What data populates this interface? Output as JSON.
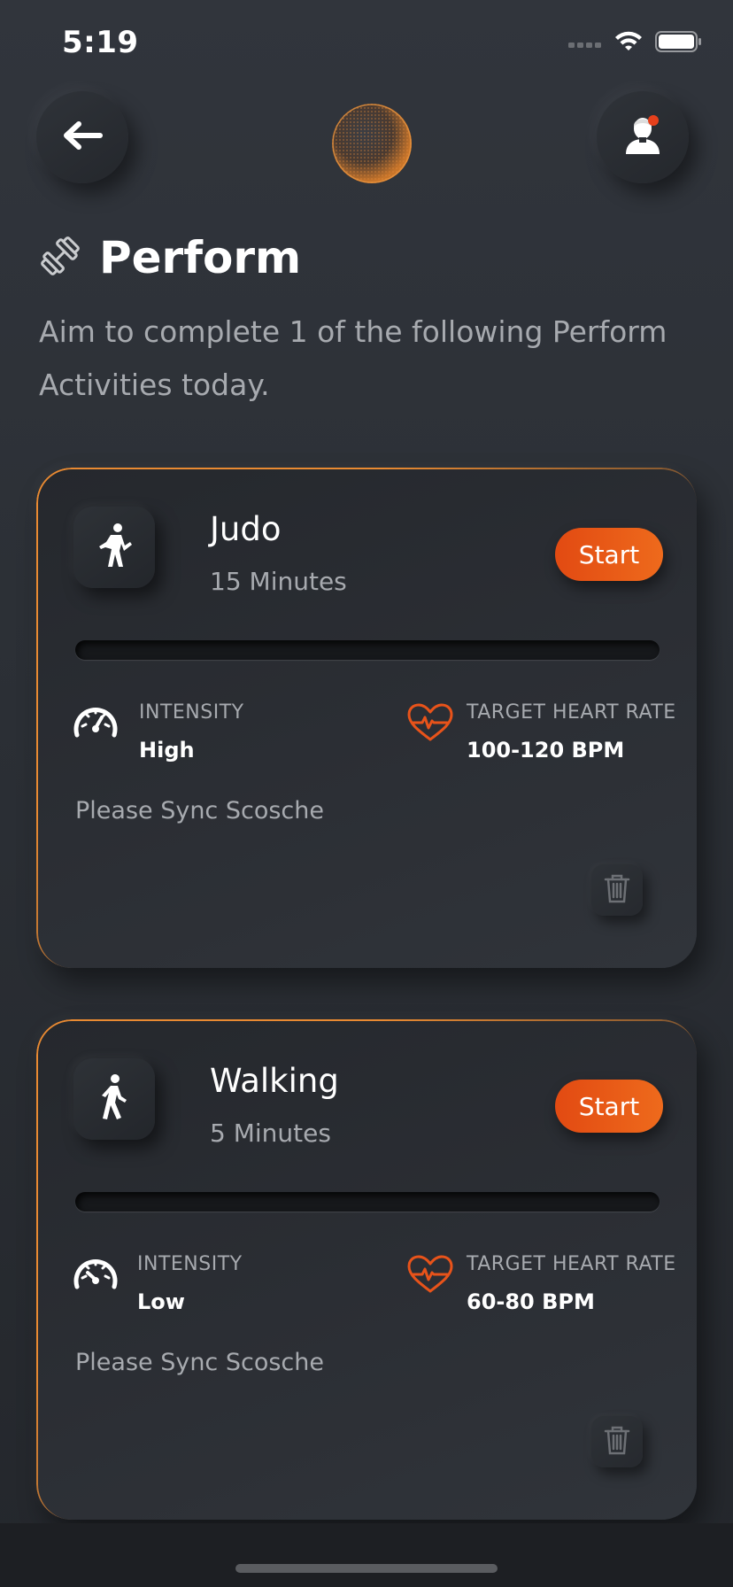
{
  "status_bar": {
    "time": "5:19"
  },
  "header": {
    "back_icon": "arrow-left-icon",
    "center_icon": "orb-logo",
    "profile_icon": "user-notification-icon",
    "notification_color": "#e6401c"
  },
  "page": {
    "icon": "dumbbell-icon",
    "title": "Perform",
    "subtitle": "Aim to complete 1 of the following Perform Activities today."
  },
  "accent_color": "#e8531a",
  "activities": [
    {
      "name": "Judo",
      "duration": "15 Minutes",
      "start_label": "Start",
      "progress": 0,
      "intensity_label": "INTENSITY",
      "intensity": "High",
      "heart_rate_label": "TARGET HEART RATE",
      "heart_rate": "100-120 BPM",
      "sync_message": "Please Sync Scosche",
      "icon": "judo-person-icon"
    },
    {
      "name": "Walking",
      "duration": "5 Minutes",
      "start_label": "Start",
      "progress": 0,
      "intensity_label": "INTENSITY",
      "intensity": "Low",
      "heart_rate_label": "TARGET HEART RATE",
      "heart_rate": "60-80 BPM",
      "sync_message": "Please Sync Scosche",
      "icon": "walking-person-icon"
    }
  ]
}
